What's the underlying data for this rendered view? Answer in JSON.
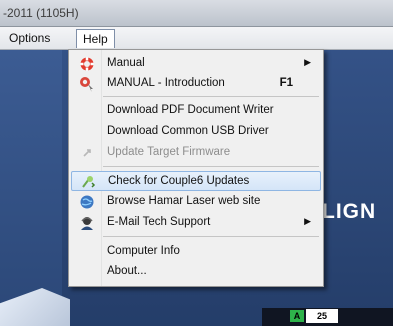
{
  "window": {
    "title": "-2011 (1105H)"
  },
  "menubar": {
    "options": "Options",
    "help": "Help"
  },
  "help_menu": {
    "items": [
      {
        "label": "Manual",
        "shortcut": "",
        "submenu": true,
        "enabled": true,
        "icon": "lifebuoy-icon"
      },
      {
        "label": "MANUAL - Introduction",
        "shortcut": "F1",
        "submenu": false,
        "enabled": true,
        "icon": "help-pointer-icon"
      },
      {
        "label": "Download PDF Document Writer",
        "shortcut": "",
        "submenu": false,
        "enabled": true,
        "icon": ""
      },
      {
        "label": "Download Common USB Driver",
        "shortcut": "",
        "submenu": false,
        "enabled": true,
        "icon": ""
      },
      {
        "label": "Update Target Firmware",
        "shortcut": "",
        "submenu": false,
        "enabled": false,
        "icon": "firmware-icon"
      },
      {
        "label": "Check for Couple6 Updates",
        "shortcut": "",
        "submenu": false,
        "enabled": true,
        "highlighted": true,
        "icon": "update-check-icon"
      },
      {
        "label": "Browse Hamar Laser  web site",
        "shortcut": "",
        "submenu": false,
        "enabled": true,
        "icon": "globe-icon"
      },
      {
        "label": "E-Mail Tech Support",
        "shortcut": "",
        "submenu": true,
        "enabled": true,
        "icon": "support-agent-icon"
      },
      {
        "label": "Computer Info",
        "shortcut": "",
        "submenu": false,
        "enabled": true,
        "icon": ""
      },
      {
        "label": "About...",
        "shortcut": "",
        "submenu": false,
        "enabled": true,
        "icon": ""
      }
    ]
  },
  "background": {
    "partial_text": "LIGN"
  },
  "status": {
    "indicator": "A",
    "value": "25"
  },
  "colors": {
    "highlight": "#d4e5f8",
    "background_blue": "#2f4a78",
    "led_green": "#2eb34b"
  }
}
